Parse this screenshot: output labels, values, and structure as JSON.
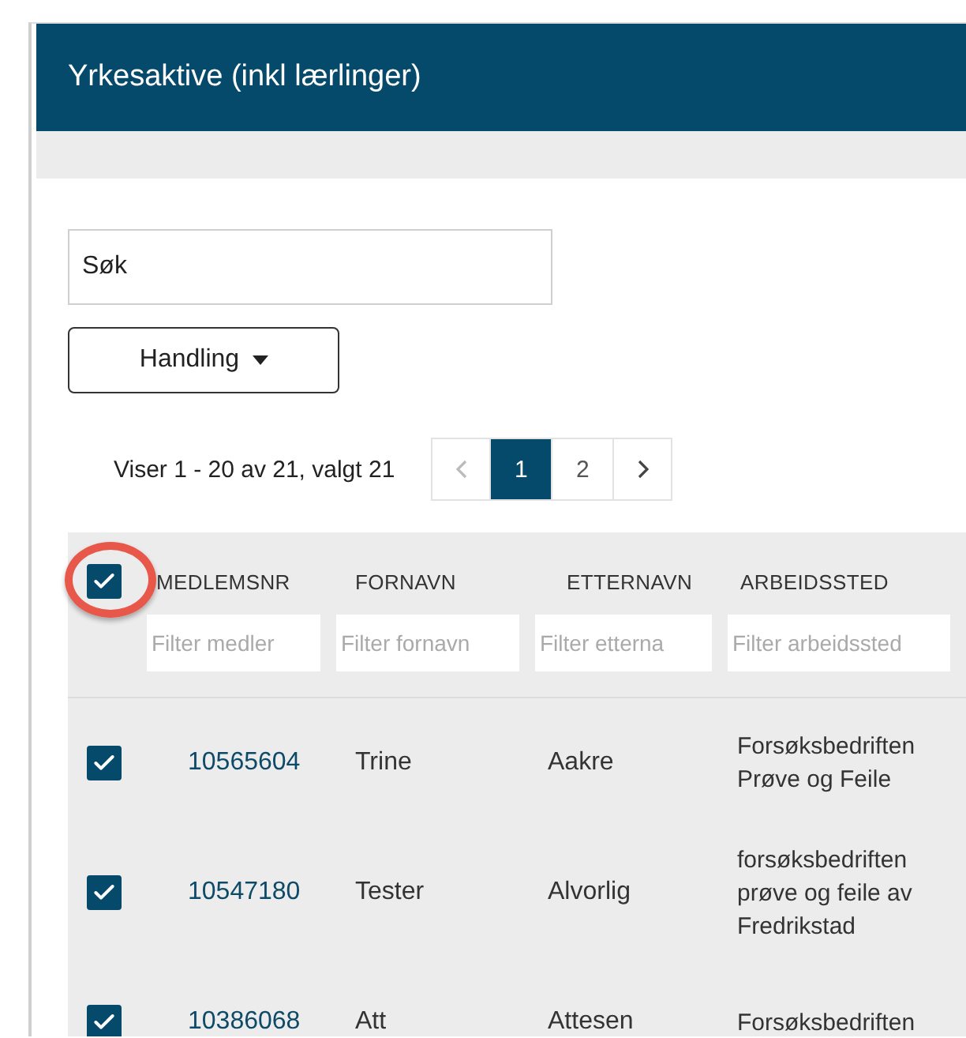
{
  "header": {
    "title": "Yrkesaktive (inkl lærlinger)"
  },
  "search": {
    "placeholder": "Søk"
  },
  "action_button": {
    "label": "Handling"
  },
  "pagination": {
    "summary": "Viser 1 - 20 av 21, valgt 21",
    "prev_disabled": true,
    "next_disabled": false,
    "pages": [
      {
        "label": "1",
        "selected": true
      },
      {
        "label": "2",
        "selected": false
      }
    ]
  },
  "table": {
    "select_all_checked": true,
    "select_all_highlighted": true,
    "columns": [
      {
        "label": "MEDLEMSNR",
        "filter_placeholder": "Filter medler"
      },
      {
        "label": "FORNAVN",
        "filter_placeholder": "Filter fornavn"
      },
      {
        "label": "ETTERNAVN",
        "filter_placeholder": "Filter etterna"
      },
      {
        "label": "ARBEIDSSTED",
        "filter_placeholder": "Filter arbeidssted"
      }
    ],
    "rows": [
      {
        "checked": true,
        "medlemsnr": "10565604",
        "fornavn": "Trine",
        "etternavn": "Aakre",
        "arbeidssted": [
          "Forsøksbedriften",
          "Prøve og Feile"
        ]
      },
      {
        "checked": true,
        "medlemsnr": "10547180",
        "fornavn": "Tester",
        "etternavn": "Alvorlig",
        "arbeidssted": [
          "forsøksbedriften",
          "prøve og feile av",
          "Fredrikstad"
        ]
      },
      {
        "checked": true,
        "medlemsnr": "10386068",
        "fornavn": "Att",
        "etternavn": "Attesen",
        "arbeidssted": [
          "Forsøksbedriften"
        ]
      }
    ]
  }
}
